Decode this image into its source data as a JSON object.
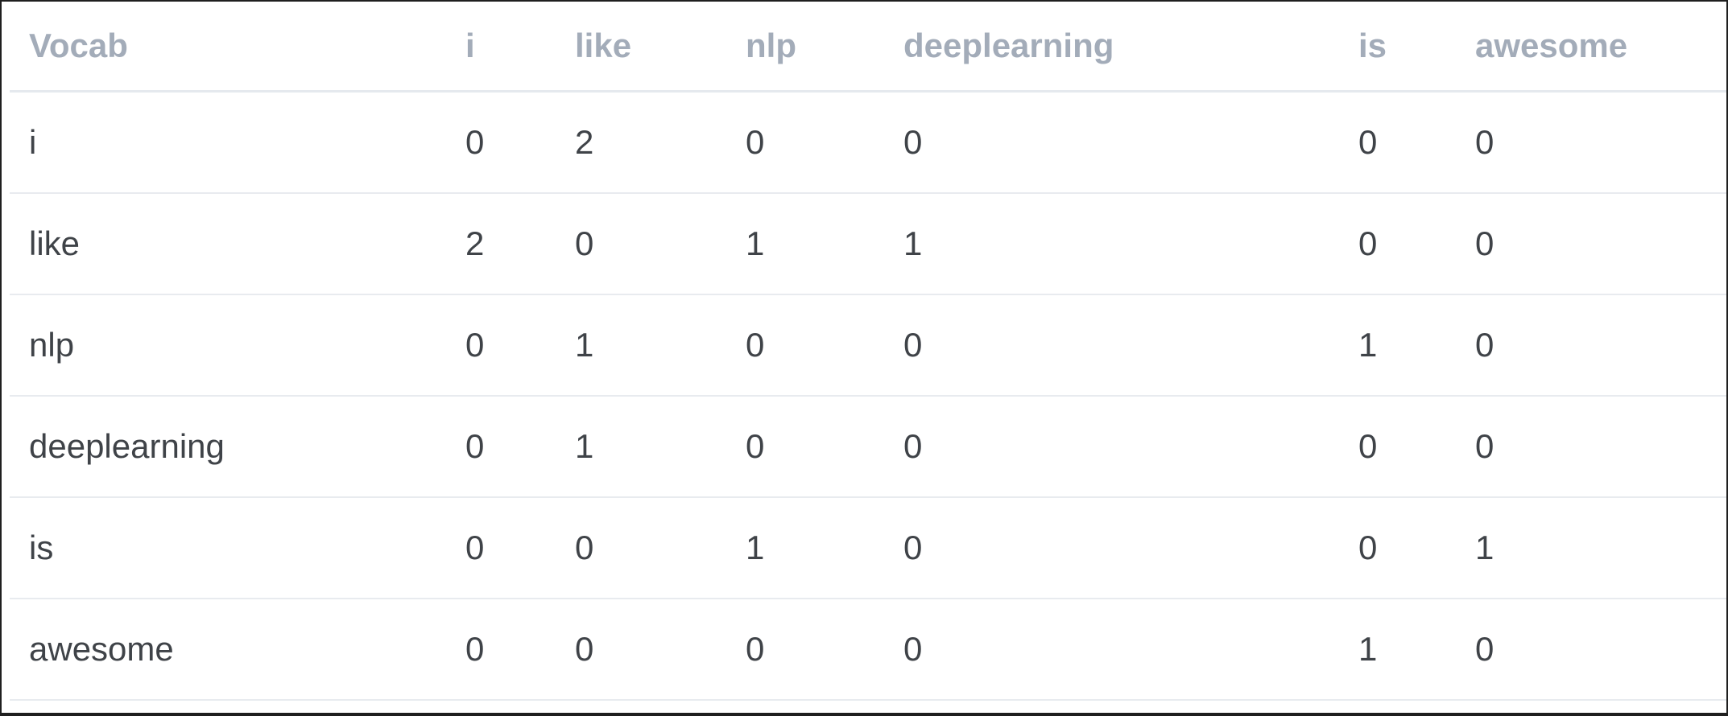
{
  "table": {
    "columns": [
      "Vocab",
      "i",
      "like",
      "nlp",
      "deeplearning",
      "is",
      "awesome"
    ],
    "rows": [
      {
        "word": "i",
        "values": [
          "0",
          "2",
          "0",
          "0",
          "0",
          "0"
        ]
      },
      {
        "word": "like",
        "values": [
          "2",
          "0",
          "1",
          "1",
          "0",
          "0"
        ]
      },
      {
        "word": "nlp",
        "values": [
          "0",
          "1",
          "0",
          "0",
          "1",
          "0"
        ]
      },
      {
        "word": "deeplearning",
        "values": [
          "0",
          "1",
          "0",
          "0",
          "0",
          "0"
        ]
      },
      {
        "word": "is",
        "values": [
          "0",
          "0",
          "1",
          "0",
          "0",
          "1"
        ]
      },
      {
        "word": "awesome",
        "values": [
          "0",
          "0",
          "0",
          "0",
          "1",
          "0"
        ]
      }
    ]
  },
  "colors": {
    "header_text": "#a3acb9",
    "body_text": "#3f4348",
    "row_divider": "#e8ebef",
    "background": "#ffffff"
  }
}
